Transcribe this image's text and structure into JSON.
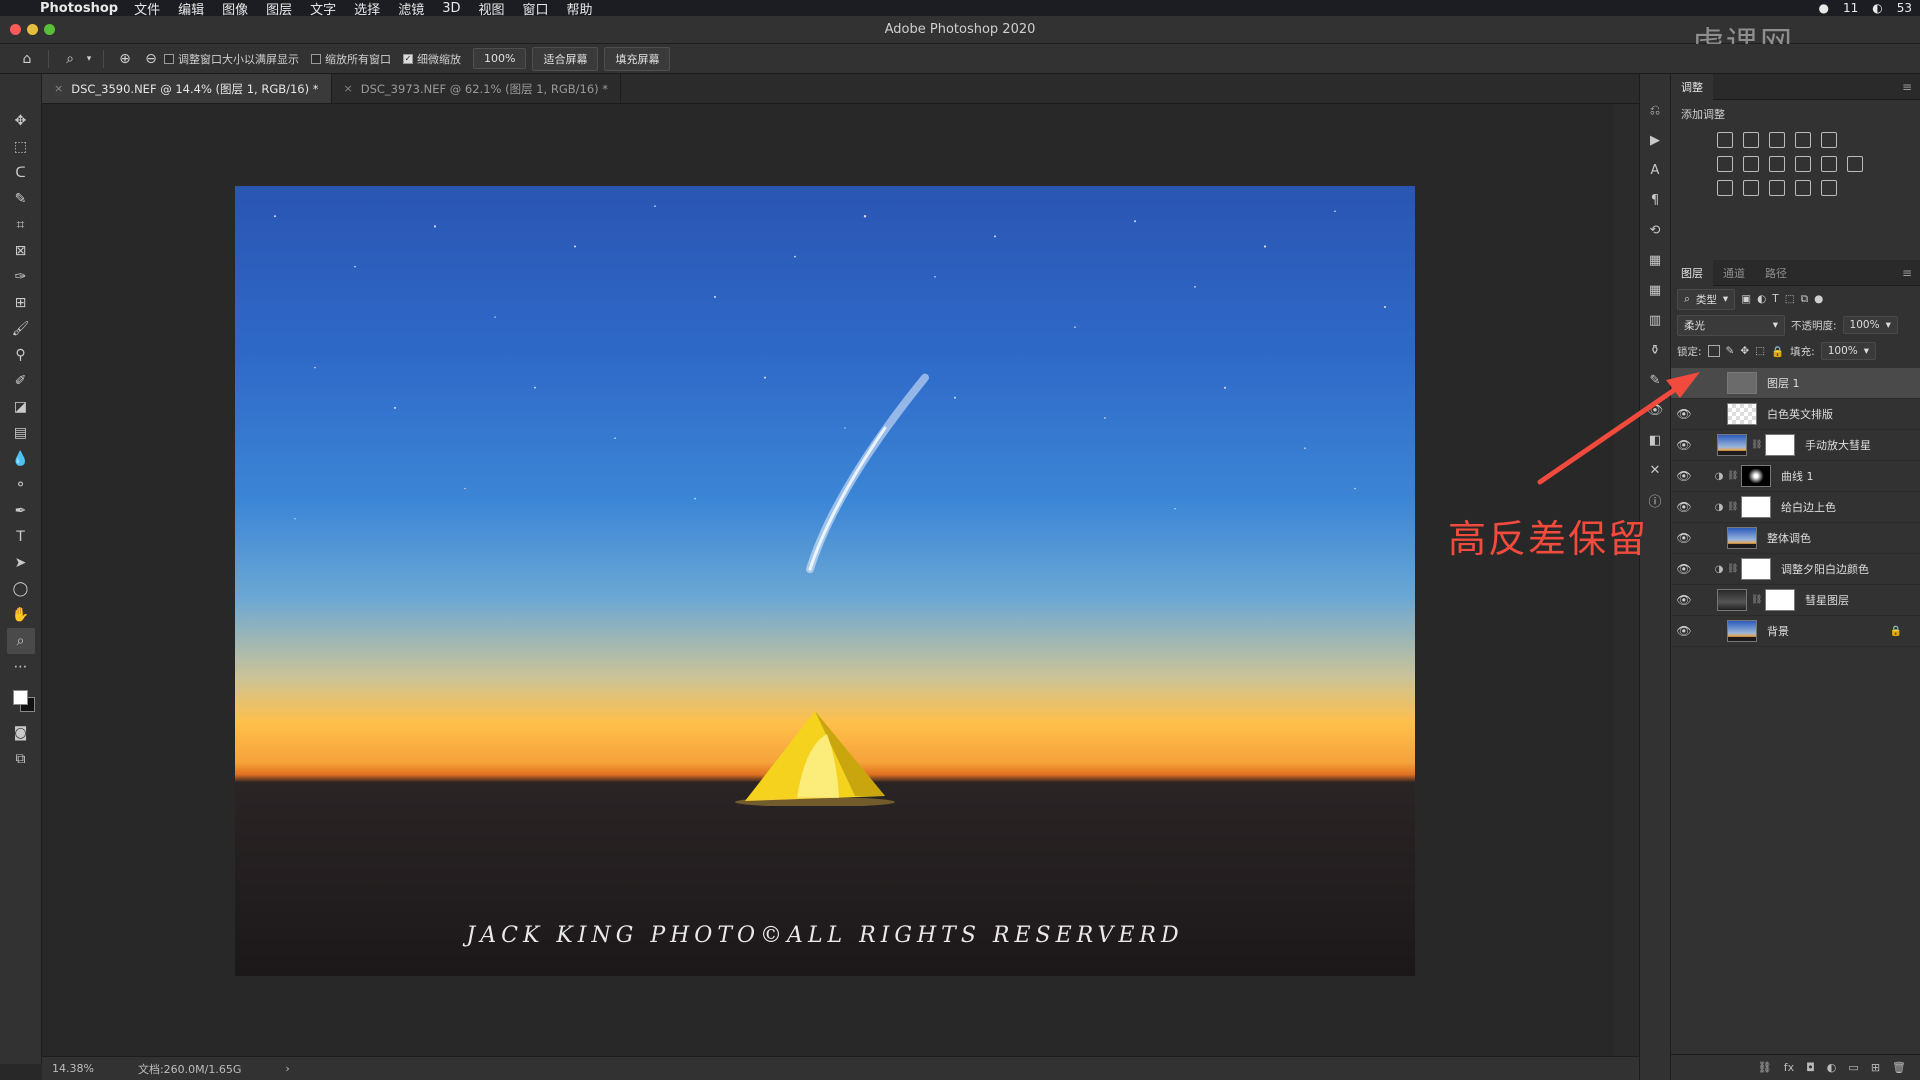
{
  "menubar": {
    "apple": "",
    "app_name": "Photoshop",
    "items": [
      "文件",
      "编辑",
      "图像",
      "图层",
      "文字",
      "选择",
      "滤镜",
      "3D",
      "视图",
      "窗口",
      "帮助"
    ],
    "right": [
      "11",
      "53"
    ]
  },
  "window": {
    "title": "Adobe Photoshop 2020"
  },
  "options": {
    "zoom_value": "100%",
    "checkboxes": [
      {
        "label": "调整窗口大小以满屏显示",
        "checked": false
      },
      {
        "label": "缩放所有窗口",
        "checked": false
      },
      {
        "label": "细微缩放",
        "checked": true
      }
    ],
    "buttons": [
      "适合屏幕",
      "填充屏幕"
    ]
  },
  "doc_tabs": [
    {
      "label": "DSC_3590.NEF @ 14.4% (图层 1, RGB/16) *",
      "active": true
    },
    {
      "label": "DSC_3973.NEF @ 62.1% (图层 1, RGB/16) *",
      "active": false
    }
  ],
  "canvas": {
    "watermark": "JACK KING PHOTO©ALL RIGHTS RESERVERD"
  },
  "status": {
    "zoom": "14.38%",
    "doc": "文档:260.0M/1.65G",
    "arrow": "›"
  },
  "adjust_panel": {
    "tab": "调整",
    "subtitle": "添加调整"
  },
  "layers_panel": {
    "tabs": [
      "图层",
      "通道",
      "路径"
    ],
    "kind_label": "类型",
    "blend_mode": "柔光",
    "opacity_label": "不透明度:",
    "opacity_value": "100%",
    "lock_label": "锁定:",
    "fill_label": "填充:",
    "fill_value": "100%",
    "layers": [
      {
        "name": "图层 1",
        "thumb": "gray",
        "selected": true
      },
      {
        "name": "白色英文排版",
        "thumb": "checker"
      },
      {
        "name": "手动放大彗星",
        "thumb": "sky",
        "mask": "white"
      },
      {
        "name": "曲线 1",
        "adj": true,
        "mask": "black"
      },
      {
        "name": "给白边上色",
        "adj": true,
        "mask": "white"
      },
      {
        "name": "整体调色",
        "thumb": "sky"
      },
      {
        "name": "调整夕阳白边颜色",
        "adj": true,
        "mask": "white"
      },
      {
        "name": "彗星图层",
        "thumb": "darkstrip",
        "mask": "white"
      },
      {
        "name": "背景",
        "thumb": "sky",
        "locked": true
      }
    ],
    "bottom_icons": [
      "link-icon",
      "fx",
      "mask-icon",
      "adjustment-icon",
      "folder-icon",
      "new-layer-icon",
      "trash-icon"
    ]
  },
  "annotation": {
    "text": "高反差保留",
    "color": "#f24a3c"
  },
  "brand_watermark": "虎课网"
}
